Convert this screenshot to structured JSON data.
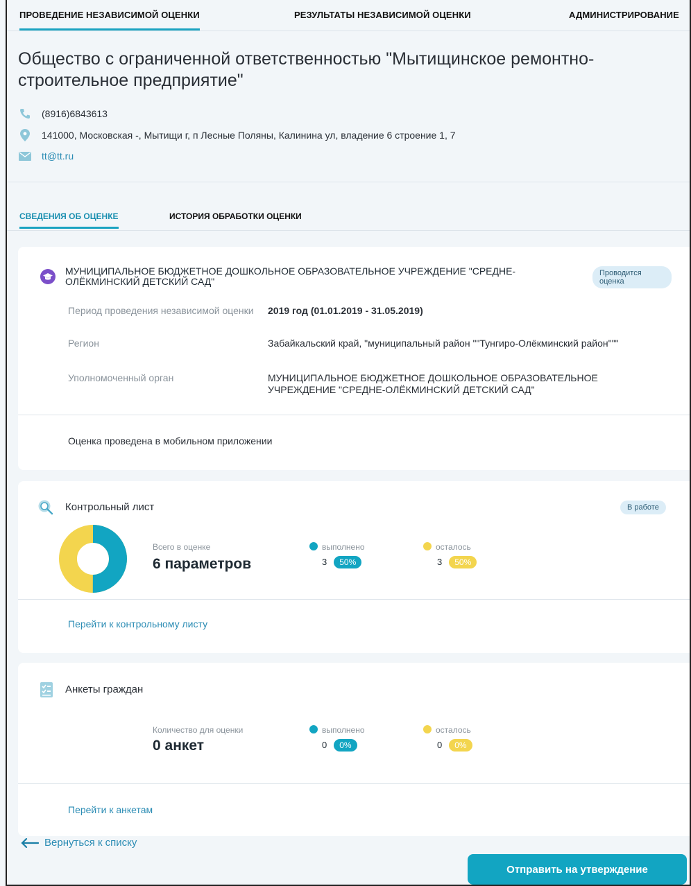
{
  "nav": {
    "tabs": [
      {
        "label": "ПРОВЕДЕНИЕ НЕЗАВИСИМОЙ ОЦЕНКИ"
      },
      {
        "label": "РЕЗУЛЬТАТЫ НЕЗАВИСИМОЙ ОЦЕНКИ"
      },
      {
        "label": "АДМИНИСТРИРОВАНИЕ"
      }
    ]
  },
  "org": {
    "title": "Общество с ограниченной ответственностью \"Мытищинское ремонтно-строительное предприятие\"",
    "phone": "(8916)6843613",
    "address": "141000, Московская -, Мытищи г, п Лесные Поляны, Калинина ул, владение 6 строение 1, 7",
    "email": "tt@tt.ru"
  },
  "subtabs": [
    {
      "label": "СВЕДЕНИЯ ОБ ОЦЕНКЕ"
    },
    {
      "label": "ИСТОРИЯ ОБРАБОТКИ ОЦЕНКИ"
    }
  ],
  "assessment": {
    "institution": "МУНИЦИПАЛЬНОЕ БЮДЖЕТНОЕ ДОШКОЛЬНОЕ ОБРАЗОВАТЕЛЬНОЕ УЧРЕЖДЕНИЕ \"СРЕДНЕ-ОЛЁКМИНСКИЙ ДЕТСКИЙ САД\"",
    "status": "Проводится оценка",
    "period_label": "Период проведения независимой оценки",
    "period_value": "2019 год (01.01.2019 - 31.05.2019)",
    "region_label": "Регион",
    "region_value": "Забайкальский край, \"муниципальный район \"\"Тунгиро-Олёкминский район\"\"\"",
    "authority_label": "Уполномоченный орган",
    "authority_value": "МУНИЦИПАЛЬНОЕ БЮДЖЕТНОЕ ДОШКОЛЬНОЕ ОБРАЗОВАТЕЛЬНОЕ УЧРЕЖДЕНИЕ \"СРЕДНЕ-ОЛЁКМИНСКИЙ ДЕТСКИЙ САД\"",
    "mobile_note": "Оценка проведена в мобильном приложении"
  },
  "checklist": {
    "title": "Контрольный лист",
    "status": "В работе",
    "total_label": "Всего в оценке",
    "total_value": "6 параметров",
    "done_label": "выполнено",
    "done_count": "3",
    "done_pct": "50%",
    "left_label": "осталось",
    "left_count": "3",
    "left_pct": "50%",
    "done_fraction": 0.5,
    "link": "Перейти к контрольному листу"
  },
  "surveys": {
    "title": "Анкеты граждан",
    "total_label": "Количество для оценки",
    "total_value": "0 анкет",
    "done_label": "выполнено",
    "done_count": "0",
    "done_pct": "0%",
    "left_label": "осталось",
    "left_count": "0",
    "left_pct": "0%",
    "link": "Перейти к анкетам"
  },
  "footer": {
    "back": "Вернуться к списку",
    "send": "Отправить на утверждение"
  },
  "colors": {
    "accent": "#1aa3c1",
    "done": "#12a5c2",
    "left": "#f3d54e",
    "link": "#2b8cb4"
  }
}
